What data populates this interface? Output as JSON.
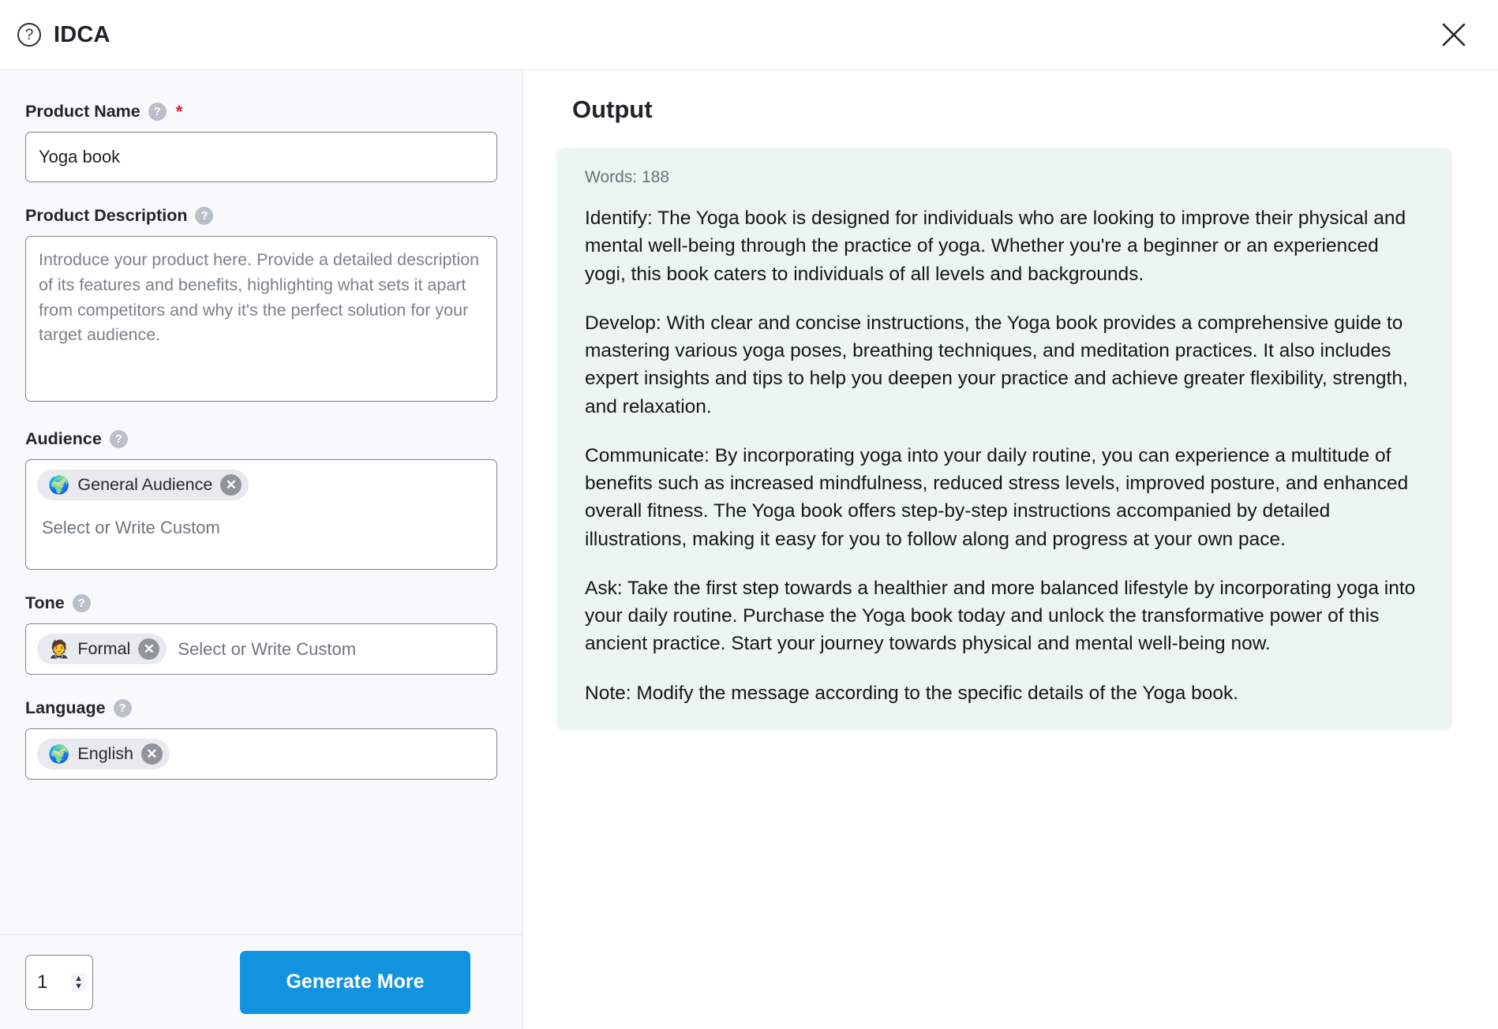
{
  "header": {
    "title": "IDCA",
    "help_icon": "question-mark-circle-icon",
    "close_icon": "close-icon"
  },
  "form": {
    "product_name": {
      "label": "Product Name",
      "required_marker": "*",
      "value": "Yoga book",
      "placeholder": ""
    },
    "product_description": {
      "label": "Product Description",
      "value": "",
      "placeholder": "Introduce your product here. Provide a detailed description of its features and benefits, highlighting what sets it apart from competitors and why it's the perfect solution for your target audience."
    },
    "audience": {
      "label": "Audience",
      "chips": [
        {
          "emoji": "🌍",
          "label": "General Audience",
          "remove": "✕"
        }
      ],
      "placeholder": "Select or Write Custom"
    },
    "tone": {
      "label": "Tone",
      "chips": [
        {
          "emoji": "🤵",
          "label": "Formal",
          "remove": "✕"
        }
      ],
      "placeholder": "Select or Write Custom"
    },
    "language": {
      "label": "Language",
      "chips": [
        {
          "emoji": "🌍",
          "label": "English",
          "remove": "✕"
        }
      ],
      "placeholder": ""
    },
    "help_badge": "?"
  },
  "footer": {
    "count_value": "1",
    "increment_icon": "chevron-up-icon",
    "decrement_icon": "chevron-down-icon",
    "generate_label": "Generate More"
  },
  "output": {
    "title": "Output",
    "words_label": "Words: 188",
    "paragraphs": [
      "Identify: The Yoga book is designed for individuals who are looking to improve their physical and mental well-being through the practice of yoga. Whether you're a beginner or an experienced yogi, this book caters to individuals of all levels and backgrounds.",
      "Develop: With clear and concise instructions, the Yoga book provides a comprehensive guide to mastering various yoga poses, breathing techniques, and meditation practices. It also includes expert insights and tips to help you deepen your practice and achieve greater flexibility, strength, and relaxation.",
      "Communicate: By incorporating yoga into your daily routine, you can experience a multitude of benefits such as increased mindfulness, reduced stress levels, improved posture, and enhanced overall fitness. The Yoga book offers step-by-step instructions accompanied by detailed illustrations, making it easy for you to follow along and progress at your own pace.",
      "Ask: Take the first step towards a healthier and more balanced lifestyle by incorporating yoga into your daily routine. Purchase the Yoga book today and unlock the transformative power of this ancient practice. Start your journey towards physical and mental well-being now.",
      "Note: Modify the message according to the specific details of the Yoga book."
    ]
  },
  "colors": {
    "accent": "#1193e0",
    "output_bg": "#edf5f0",
    "panel_bg": "#f8f9fb",
    "required": "#e8122a"
  }
}
